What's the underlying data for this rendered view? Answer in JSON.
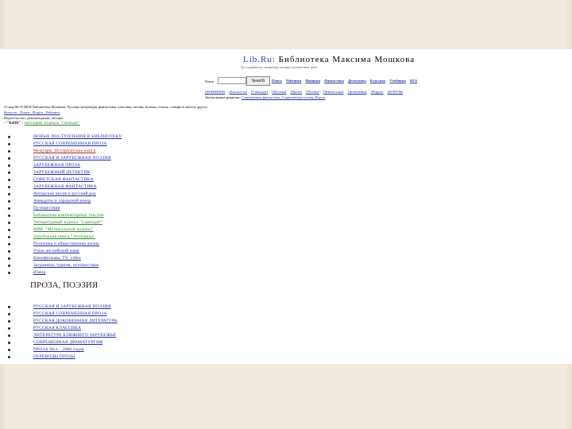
{
  "header": {
    "site": "Lib.Ru:",
    "title": "Библиотека Максима Мошкова",
    "subtitle": "Тут содержится: литература, музыка, путешествия, фото"
  },
  "search": {
    "label": "Поиск:",
    "placeholder": "",
    "button": "Search"
  },
  "toplinks": [
    "Поиск",
    "Рейтинги",
    "Новинки",
    "Фантастика",
    "Детективы",
    "Классика",
    "Учебники",
    "RUS"
  ],
  "nav1": [
    "[НОВИНКИ]",
    "[Каталог.ru]",
    "[Самиздат]",
    "[Музыка]",
    "[Проза]",
    "[Поэзия]",
    "[Фантастика]",
    "[Детективы]",
    "[Форум]",
    "[ФОРУМ]"
  ],
  "nav2": {
    "prefix": "Актуальные разделы:",
    "link": "Современная фантастика, Современная поэзия, Форум"
  },
  "news": {
    "line1": "23 мар 06.55 МСК Библиотека Мошкова: Русская литература, фантастика, классика, поэзия, музыка, статьи, словари и многое другое.",
    "line2": "Новости · Поиск · Форум · Рейтинги",
    "line3": "Издательство, рекомендации, авторы",
    "line4_prefix": "- \"Refill\" - ",
    "line4_link": "ежегодник журнала \"Самиздат\""
  },
  "categories_top": [
    {
      "count": "",
      "label": "НОВЫЕ ПОСТУПЛЕНИЯ В БИБЛИОТЕКУ",
      "style": "normal"
    },
    {
      "count": "",
      "label": "РУССКАЯ СОВРЕМЕННАЯ ПРОЗА",
      "style": "normal"
    },
    {
      "count": "",
      "label": "Мемуары. Исторические книги",
      "style": "red"
    },
    {
      "count": "",
      "label": "РУССКАЯ И ЗАРУБЕЖНАЯ ПОЭЗИЯ",
      "style": "normal"
    },
    {
      "count": "",
      "label": "ЗАРУБЕЖНАЯ ПРОЗА",
      "style": "normal"
    },
    {
      "count": "",
      "label": "ЗАРУБЕЖНЫЙ ДЕТЕКТИВ",
      "style": "normal"
    },
    {
      "count": "",
      "label": "СОВЕТСКАЯ ФАНТАСТИКА",
      "style": "normal"
    },
    {
      "count": "",
      "label": "ЗАРУБЕЖНАЯ ФАНТАСТИКА",
      "style": "normal"
    },
    {
      "count": "",
      "label": "Авторская песня и русский рок",
      "style": "normal"
    },
    {
      "count": "",
      "label": "Анекдоты и городской юмор",
      "style": "normal"
    },
    {
      "count": "",
      "label": "Путешествия",
      "style": "normal"
    },
    {
      "count": "",
      "label": "Библиотека компьютерных текстов",
      "style": "green"
    },
    {
      "count": "",
      "label": "Литературный журнал \"Самиздат\"",
      "style": "green"
    },
    {
      "count": "",
      "label": "МРЯ: \"Музыкальный журнал\"",
      "style": "green"
    },
    {
      "count": "",
      "label": "Зарубежная книга \"Эзотерика\"",
      "style": "green"
    },
    {
      "count": "",
      "label": "Политика и общественная жизнь",
      "style": "normal"
    },
    {
      "count": "",
      "label": "Учим английский язык",
      "style": "normal"
    },
    {
      "count": "",
      "label": "Кинофильмы, TV, video",
      "style": "normal"
    },
    {
      "count": "",
      "label": "Заграница, туризм, путешествия",
      "style": "normal"
    },
    {
      "count": "",
      "label": "Юмор",
      "style": "normal"
    }
  ],
  "section_heading": "ПРОЗА, ПОЭЗИЯ",
  "categories_prose": [
    {
      "count": "",
      "label": "РУССКАЯ И ЗАРУБЕЖНАЯ ПОЭЗИЯ",
      "style": "normal"
    },
    {
      "count": "",
      "label": "РУССКАЯ СОВРЕМЕННАЯ ПРОЗА",
      "style": "normal"
    },
    {
      "count": "",
      "label": "РУССКАЯ ДОКОВЕННАЯ ЛИТЕРАТУРА",
      "style": "normal"
    },
    {
      "count": "",
      "label": "РУССКАЯ КЛАССИКА",
      "style": "normal"
    },
    {
      "count": "",
      "label": "ЛИТЕРАТУРА БЛИЖНЕГО ЗАРУБЕЖЬЯ",
      "style": "normal"
    },
    {
      "count": "",
      "label": "СОВРЕМЕННАЯ ДРАМАТУРГИЯ",
      "style": "normal"
    },
    {
      "count": "",
      "label": "ПРОЗА 90-х - 2000 годов",
      "style": "normal"
    },
    {
      "count": "",
      "label": "ПЕРЕВОДЫ ПРОЗЫ",
      "style": "normal"
    }
  ]
}
